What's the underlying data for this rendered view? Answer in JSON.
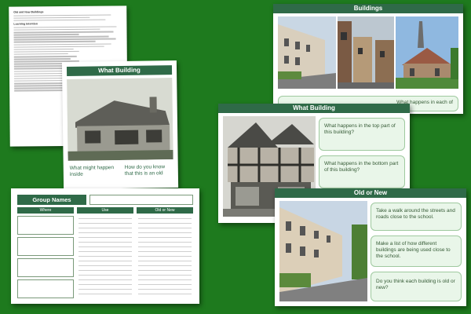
{
  "worksheet": {
    "heading_1": "Old and New Buildings",
    "heading_2": "Learning Intention"
  },
  "what_building_card": {
    "title": "What Building",
    "caption_left": "What might happen inside",
    "caption_right": "How do you know that this is an old"
  },
  "group_names_card": {
    "title": "Group Names",
    "columns": [
      "Where",
      "Use",
      "Old or New"
    ]
  },
  "buildings_card": {
    "title": "Buildings",
    "prompt_fragment": "What happens in each of"
  },
  "what_building_2_card": {
    "title": "What Building",
    "questions": [
      "What happens in the top part of this building?",
      "What happens in the bottom part of this building?"
    ]
  },
  "old_or_new_card": {
    "title": "Old or New",
    "tasks": [
      "Take a walk around the streets and roads close to the school.",
      "Make a list of how different buildings are being used close to the school.",
      "Do you think each building is old or new?"
    ]
  },
  "colors": {
    "background": "#1e7a1e",
    "header": "#2f6a48",
    "question_box": "#e9f6e9"
  }
}
